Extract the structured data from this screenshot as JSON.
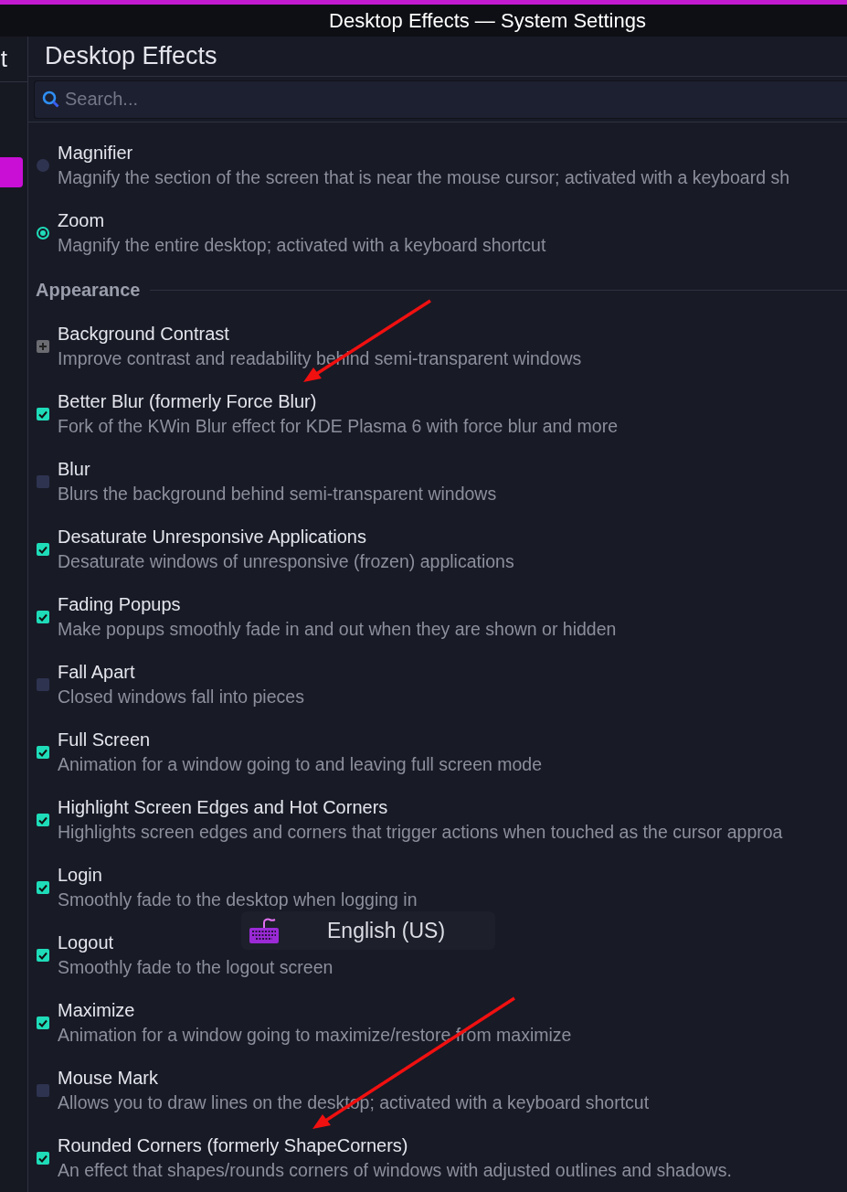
{
  "window": {
    "title": "Desktop Effects — System Settings"
  },
  "sidebar": {
    "heading_fragment": "t",
    "items": [
      {
        "selected": true
      }
    ]
  },
  "page": {
    "title": "Desktop Effects"
  },
  "search": {
    "placeholder": "Search..."
  },
  "effects": [
    {
      "kind": "radio",
      "title": "Magnifier",
      "description": "Magnify the section of the screen that is near the mouse cursor; activated with a keyboard sh",
      "selected": false
    },
    {
      "kind": "radio",
      "title": "Zoom",
      "description": "Magnify the entire desktop; activated with a keyboard shortcut",
      "selected": true
    },
    {
      "kind": "section",
      "title": "Appearance"
    },
    {
      "kind": "checkbox",
      "title": "Background Contrast",
      "description": "Improve contrast and readability behind semi-transparent windows",
      "checked": true,
      "partial": true
    },
    {
      "kind": "checkbox",
      "title": "Better Blur (formerly Force Blur)",
      "description": "Fork of the KWin Blur effect for KDE Plasma 6 with force blur and more",
      "checked": true
    },
    {
      "kind": "checkbox",
      "title": "Blur",
      "description": "Blurs the background behind semi-transparent windows",
      "checked": false
    },
    {
      "kind": "checkbox",
      "title": "Desaturate Unresponsive Applications",
      "description": "Desaturate windows of unresponsive (frozen) applications",
      "checked": true
    },
    {
      "kind": "checkbox",
      "title": "Fading Popups",
      "description": "Make popups smoothly fade in and out when they are shown or hidden",
      "checked": true
    },
    {
      "kind": "checkbox",
      "title": "Fall Apart",
      "description": "Closed windows fall into pieces",
      "checked": false
    },
    {
      "kind": "checkbox",
      "title": "Full Screen",
      "description": "Animation for a window going to and leaving full screen mode",
      "checked": true
    },
    {
      "kind": "checkbox",
      "title": "Highlight Screen Edges and Hot Corners",
      "description": "Highlights screen edges and corners that trigger actions when touched as the cursor approa",
      "checked": true
    },
    {
      "kind": "checkbox",
      "title": "Login",
      "description": "Smoothly fade to the desktop when logging in",
      "checked": true
    },
    {
      "kind": "checkbox",
      "title": "Logout",
      "description": "Smoothly fade to the logout screen",
      "checked": true
    },
    {
      "kind": "checkbox",
      "title": "Maximize",
      "description": "Animation for a window going to maximize/restore from maximize",
      "checked": true
    },
    {
      "kind": "checkbox",
      "title": "Mouse Mark",
      "description": "Allows you to draw lines on the desktop; activated with a keyboard shortcut",
      "checked": false
    },
    {
      "kind": "checkbox",
      "title": "Rounded Corners (formerly ShapeCorners)",
      "description": "An effect that shapes/rounds corners of windows with adjusted outlines and shadows.",
      "checked": true
    }
  ],
  "osd": {
    "label": "English (US)"
  }
}
